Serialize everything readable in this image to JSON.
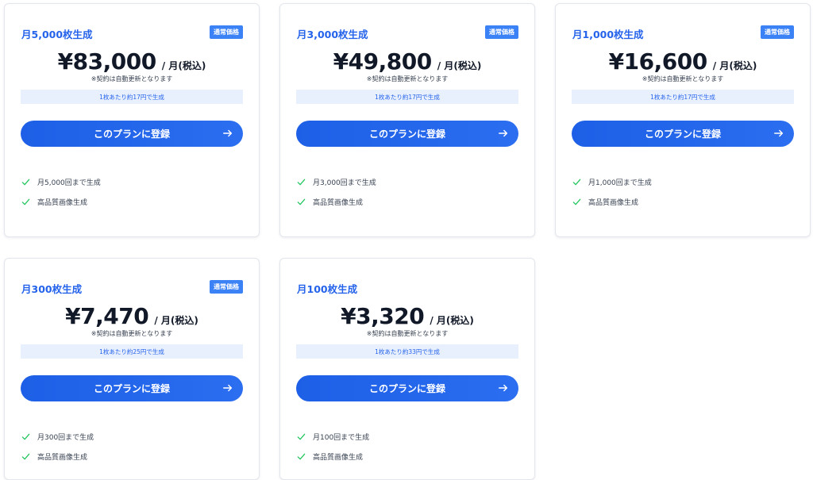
{
  "plans": [
    {
      "title": "月5,000枚生成",
      "badge": "通常価格",
      "price": "¥83,000",
      "per": "/ 月(税込)",
      "note": "※契約は自動更新となります",
      "rate": "1枚あたり約17円で生成",
      "cta": "このプランに登録",
      "features": [
        "月5,000回まで生成",
        "高品質画像生成"
      ]
    },
    {
      "title": "月3,000枚生成",
      "badge": "通常価格",
      "price": "¥49,800",
      "per": "/ 月(税込)",
      "note": "※契約は自動更新となります",
      "rate": "1枚あたり約17円で生成",
      "cta": "このプランに登録",
      "features": [
        "月3,000回まで生成",
        "高品質画像生成"
      ]
    },
    {
      "title": "月1,000枚生成",
      "badge": "通常価格",
      "price": "¥16,600",
      "per": "/ 月(税込)",
      "note": "※契約は自動更新となります",
      "rate": "1枚あたり約17円で生成",
      "cta": "このプランに登録",
      "features": [
        "月1,000回まで生成",
        "高品質画像生成"
      ]
    },
    {
      "title": "月300枚生成",
      "badge": "通常価格",
      "price": "¥7,470",
      "per": "/ 月(税込)",
      "note": "※契約は自動更新となります",
      "rate": "1枚あたり約25円で生成",
      "cta": "このプランに登録",
      "features": [
        "月300回まで生成",
        "高品質画像生成"
      ]
    },
    {
      "title": "月100枚生成",
      "price": "¥3,320",
      "per": "/ 月(税込)",
      "note": "※契約は自動更新となります",
      "rate": "1枚あたり約33円で生成",
      "cta": "このプランに登録",
      "features": [
        "月100回まで生成",
        "高品質画像生成"
      ]
    }
  ],
  "icons": {
    "cta_arrow": "arrow-right-icon",
    "feature_check": "check-icon"
  },
  "colors": {
    "accent": "#2563eb",
    "badge": "#3b82f6",
    "rate_bg": "#e8f0fd",
    "check": "#22c55e"
  }
}
